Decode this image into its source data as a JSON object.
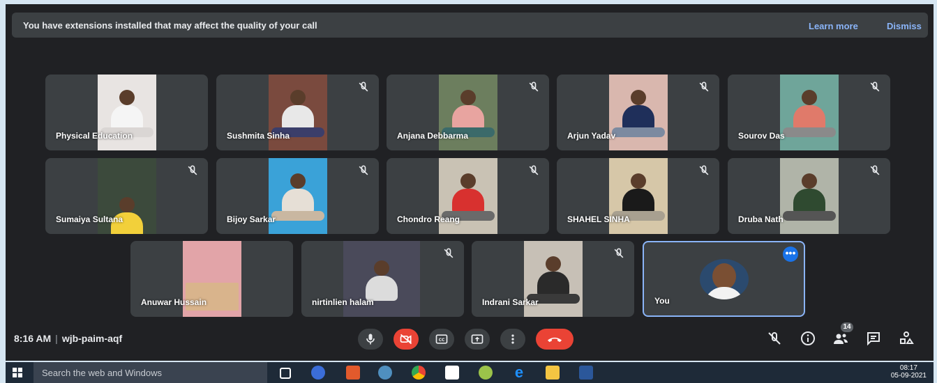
{
  "banner": {
    "message": "You have extensions installed that may affect the quality of your call",
    "learn_more": "Learn more",
    "dismiss": "Dismiss"
  },
  "participants": [
    {
      "name": "Physical Education",
      "muted": false
    },
    {
      "name": "Sushmita Sinha",
      "muted": true
    },
    {
      "name": "Anjana Debbarma",
      "muted": true
    },
    {
      "name": "Arjun Yadav",
      "muted": true
    },
    {
      "name": "Sourov Das",
      "muted": true
    },
    {
      "name": "Sumaiya Sultana",
      "muted": true
    },
    {
      "name": "Bijoy Sarkar",
      "muted": true
    },
    {
      "name": "Chondro Reang",
      "muted": true
    },
    {
      "name": "SHAHEL SINHA",
      "muted": true
    },
    {
      "name": "Druba Nath",
      "muted": true
    },
    {
      "name": "Anuwar Hussain",
      "muted": false
    },
    {
      "name": "nirtinlien halam",
      "muted": true
    },
    {
      "name": "Indrani Sarkar",
      "muted": true
    },
    {
      "name": "You",
      "muted": false
    }
  ],
  "meeting": {
    "time": "8:16 AM",
    "separator": "|",
    "code": "wjb-paim-aqf"
  },
  "controls": [
    "mic-icon",
    "camera-off-icon",
    "captions-icon",
    "present-icon",
    "more-vert-icon",
    "hangup-icon"
  ],
  "right_controls": {
    "people_count": "14"
  },
  "taskbar": {
    "search_placeholder": "Search the web and Windows",
    "time": "08:17",
    "date": "05-09-2021"
  },
  "colors": {
    "background": "#202124",
    "tile": "#3c4043",
    "accent": "#8ab4f8",
    "hangup": "#ea4335",
    "self_border": "#8ab4f8"
  }
}
